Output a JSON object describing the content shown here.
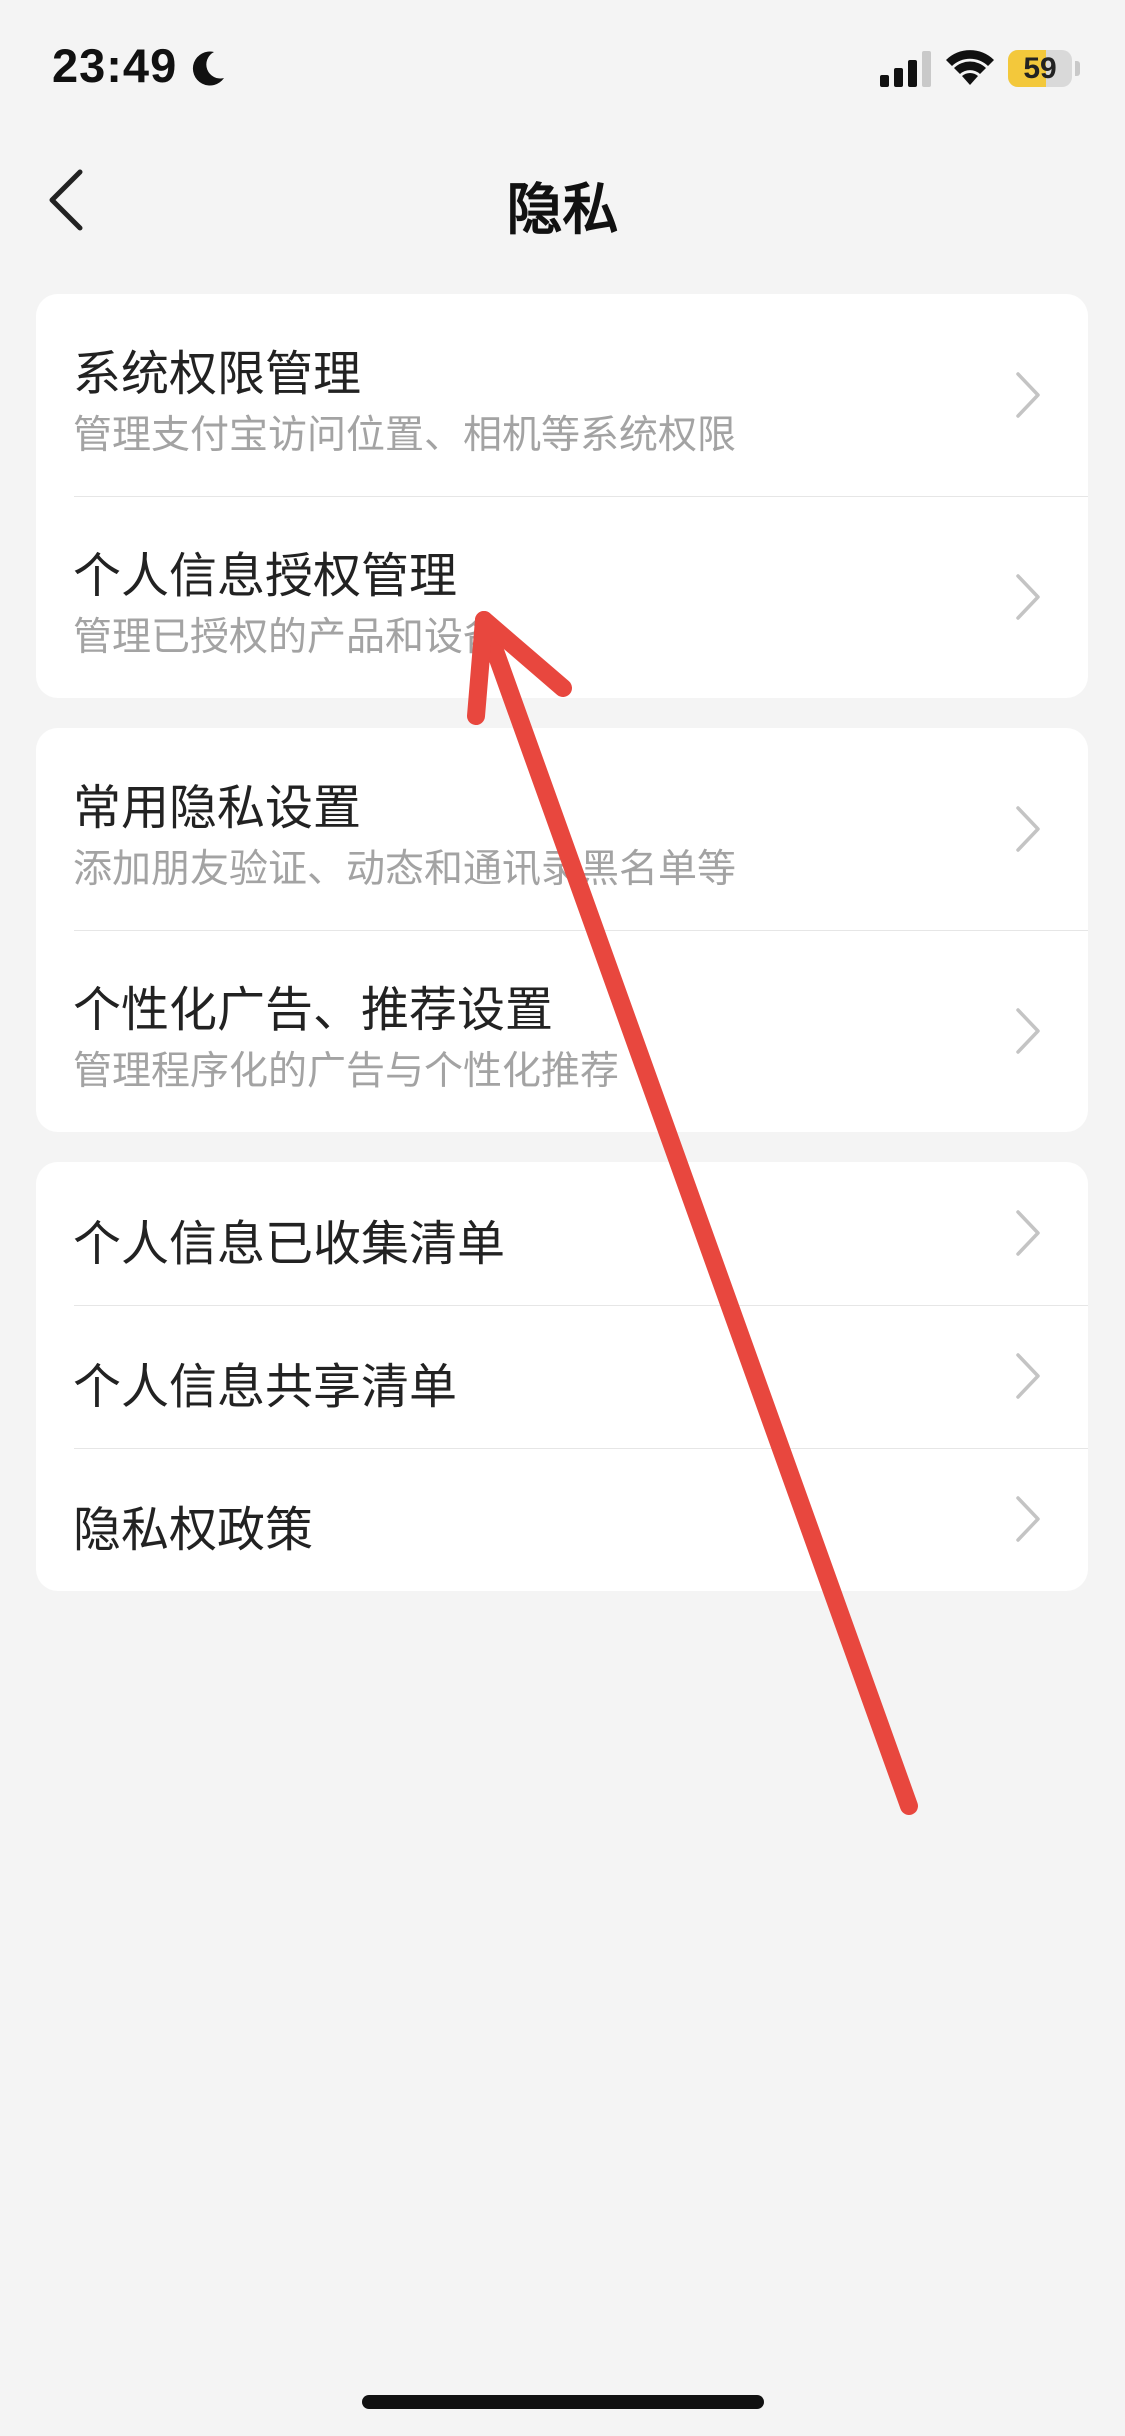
{
  "status_bar": {
    "time": "23:49",
    "battery_level": 59,
    "battery_text": "59",
    "icons": [
      "moon-icon",
      "signal-icon",
      "wifi-icon",
      "battery-icon"
    ]
  },
  "nav": {
    "title": "隐私",
    "back_icon": "chevron-left-icon"
  },
  "groups": [
    {
      "items": [
        {
          "title": "系统权限管理",
          "subtitle": "管理支付宝访问位置、相机等系统权限"
        },
        {
          "title": "个人信息授权管理",
          "subtitle": "管理已授权的产品和设备"
        }
      ]
    },
    {
      "items": [
        {
          "title": "常用隐私设置",
          "subtitle": "添加朋友验证、动态和通讯录黑名单等"
        },
        {
          "title": "个性化广告、推荐设置",
          "subtitle": "管理程序化的广告与个性化推荐"
        }
      ]
    },
    {
      "items": [
        {
          "title": "个人信息已收集清单"
        },
        {
          "title": "个人信息共享清单"
        },
        {
          "title": "隐私权政策"
        }
      ]
    }
  ],
  "colors": {
    "background": "#f4f4f4",
    "card": "#ffffff",
    "title_text": "#222222",
    "subtitle_text": "#a3a3a3",
    "chevron": "#c4c4c4",
    "battery_fill": "#f3c83b",
    "annotation_arrow": "#e8473e"
  }
}
